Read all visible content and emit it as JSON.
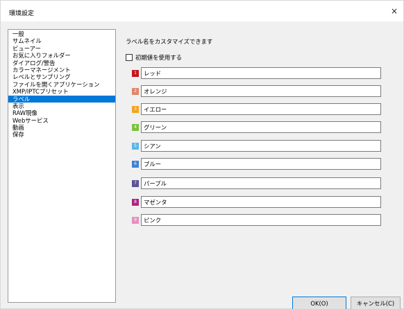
{
  "window": {
    "title": "環境設定",
    "close_glyph": "×"
  },
  "sidebar": {
    "items": [
      {
        "label": "一般"
      },
      {
        "label": "サムネイル"
      },
      {
        "label": "ビューアー"
      },
      {
        "label": "お気に入りフォルダー"
      },
      {
        "label": "ダイアログ/警告"
      },
      {
        "label": "カラーマネージメント"
      },
      {
        "label": "レベルとサンプリング"
      },
      {
        "label": "ファイルを開くアプリケーション"
      },
      {
        "label": "XMP/IPTCプリセット"
      },
      {
        "label": "ラベル",
        "selected": true
      },
      {
        "label": "表示"
      },
      {
        "label": "RAW現像"
      },
      {
        "label": "Webサービス"
      },
      {
        "label": "動画"
      },
      {
        "label": "保存"
      }
    ]
  },
  "main": {
    "heading": "ラベル名をカスタマイズできます",
    "use_default_label": "初期値を使用する",
    "use_default_checked": false,
    "labels": [
      {
        "number": "1",
        "color": "#c4161c",
        "value": "レッド"
      },
      {
        "number": "2",
        "color": "#e0866a",
        "value": "オレンジ"
      },
      {
        "number": "3",
        "color": "#f2a51e",
        "value": "イエロー"
      },
      {
        "number": "4",
        "color": "#7cc242",
        "value": "グリーン"
      },
      {
        "number": "5",
        "color": "#5bb8e8",
        "value": "シアン"
      },
      {
        "number": "6",
        "color": "#3d7fd4",
        "value": "ブルー"
      },
      {
        "number": "7",
        "color": "#5b5592",
        "value": "パープル"
      },
      {
        "number": "8",
        "color": "#b0247f",
        "value": "マゼンタ"
      },
      {
        "number": "9",
        "color": "#e58fbe",
        "value": "ピンク"
      }
    ]
  },
  "buttons": {
    "ok": "OK(O)",
    "cancel": "キャンセル(C)"
  }
}
